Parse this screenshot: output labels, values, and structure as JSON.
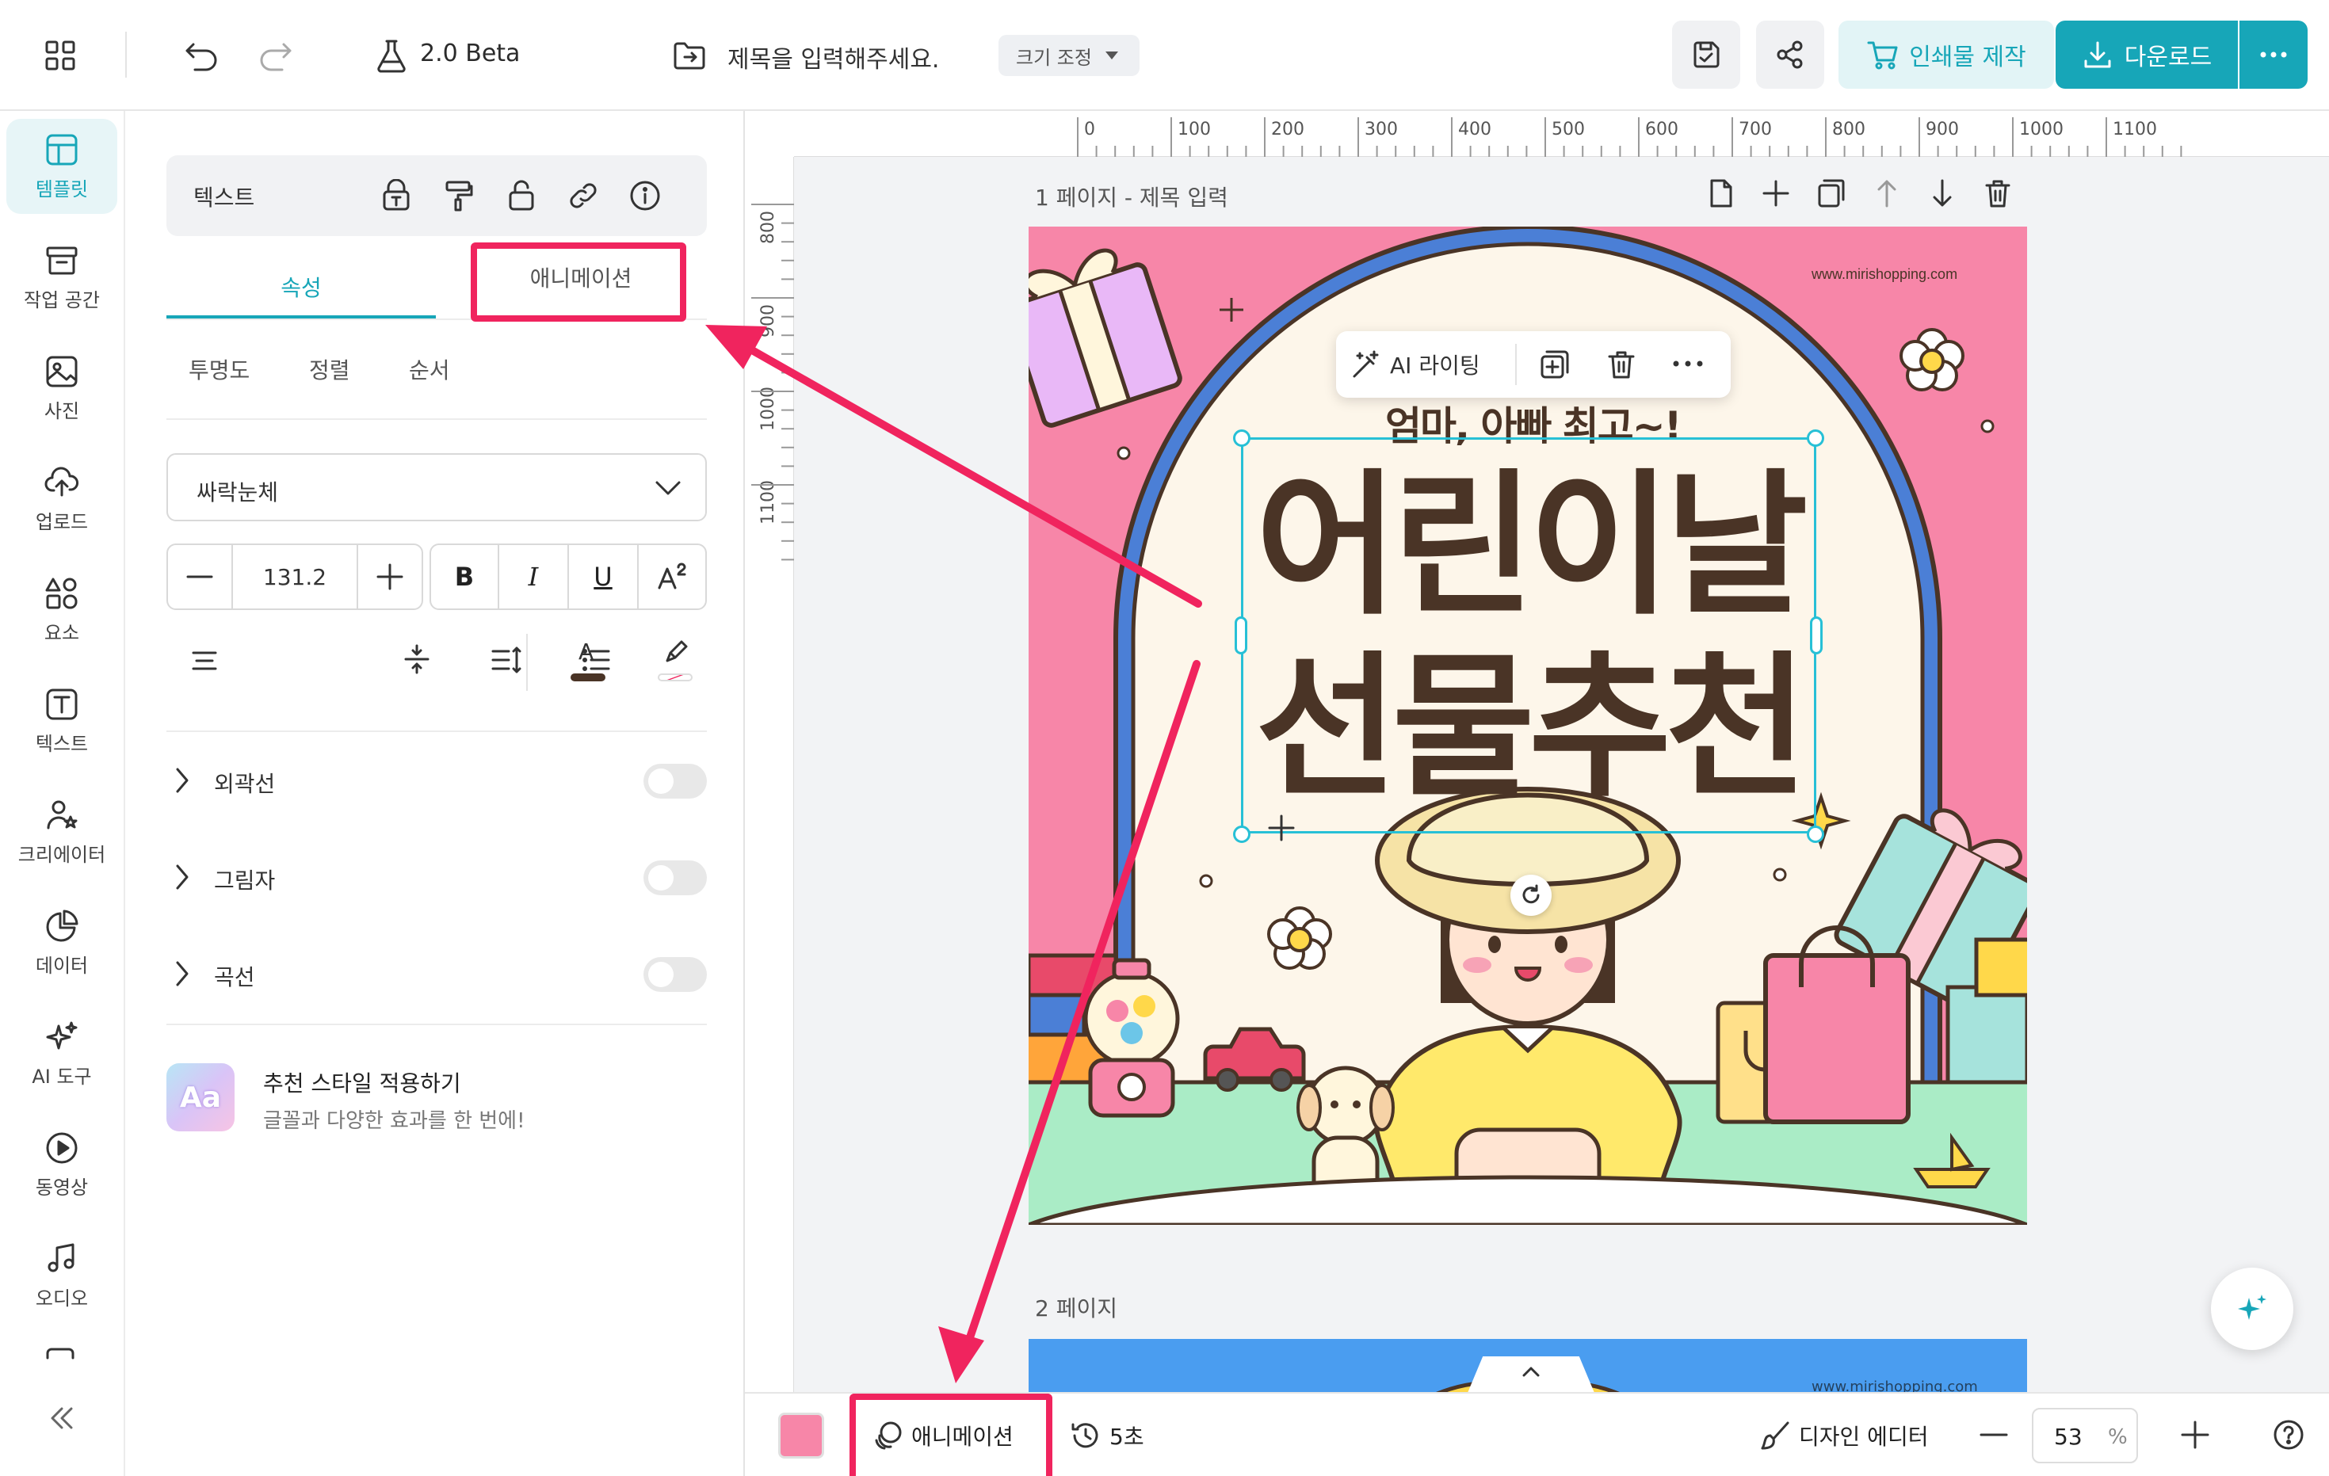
{
  "topbar": {
    "version_label": "2.0 Beta",
    "title_placeholder": "제목을 입력해주세요.",
    "resize_label": "크기 조정",
    "print_label": "인쇄물 제작",
    "download_label": "다운로드"
  },
  "rail": {
    "items": [
      {
        "label": "템플릿",
        "icon": "template-icon"
      },
      {
        "label": "작업 공간",
        "icon": "workspace-icon"
      },
      {
        "label": "사진",
        "icon": "photo-icon"
      },
      {
        "label": "업로드",
        "icon": "upload-icon"
      },
      {
        "label": "요소",
        "icon": "elements-icon"
      },
      {
        "label": "텍스트",
        "icon": "text-icon"
      },
      {
        "label": "크리에이터",
        "icon": "creator-icon"
      },
      {
        "label": "데이터",
        "icon": "data-icon"
      },
      {
        "label": "AI 도구",
        "icon": "ai-tools-icon"
      },
      {
        "label": "동영상",
        "icon": "video-icon"
      },
      {
        "label": "오디오",
        "icon": "audio-icon"
      }
    ]
  },
  "panel": {
    "header_label": "텍스트",
    "tabs": [
      "속성",
      "애니메이션"
    ],
    "sub_tabs": [
      "투명도",
      "정렬",
      "순서"
    ],
    "font_name": "싸락눈체",
    "font_size": "131.2",
    "format_buttons": [
      "B",
      "I",
      "U"
    ],
    "color_letter": "A",
    "sections": [
      "외곽선",
      "그림자",
      "곡선"
    ],
    "recommend_title": "추천 스타일 적용하기",
    "recommend_desc": "글꼴과 다양한 효과를 한 번에!",
    "recommend_icon_text": "Aa"
  },
  "ruler": {
    "h_ticks": [
      "0",
      "100",
      "200",
      "300",
      "400",
      "500",
      "600",
      "700",
      "800",
      "900",
      "1000",
      "1100"
    ],
    "v_ticks": [
      "800",
      "900",
      "1000",
      "1100"
    ]
  },
  "canvas": {
    "page1_label": "1 페이지 - 제목 입력",
    "page2_label": "2 페이지",
    "url_text": "www.mirishopping.com",
    "url_text2": "www.mirishopping.com",
    "ai_writing_label": "AI 라이팅",
    "subtitle": "엄마, 아빠 최고~!",
    "headline_line1": "어린이날",
    "headline_line2": "선물추천"
  },
  "bottombar": {
    "animation_label": "애니메이션",
    "duration_label": "5초",
    "design_editor_label": "디자인 에디터",
    "zoom_value": "53",
    "zoom_unit": "%"
  },
  "colors": {
    "accent": "#17a6b8",
    "highlight": "#f0245e",
    "poster_pink": "#f786a8",
    "arch_blue": "#4b7fd6",
    "cream": "#fdf6ea",
    "brown_text": "#4a3426"
  }
}
